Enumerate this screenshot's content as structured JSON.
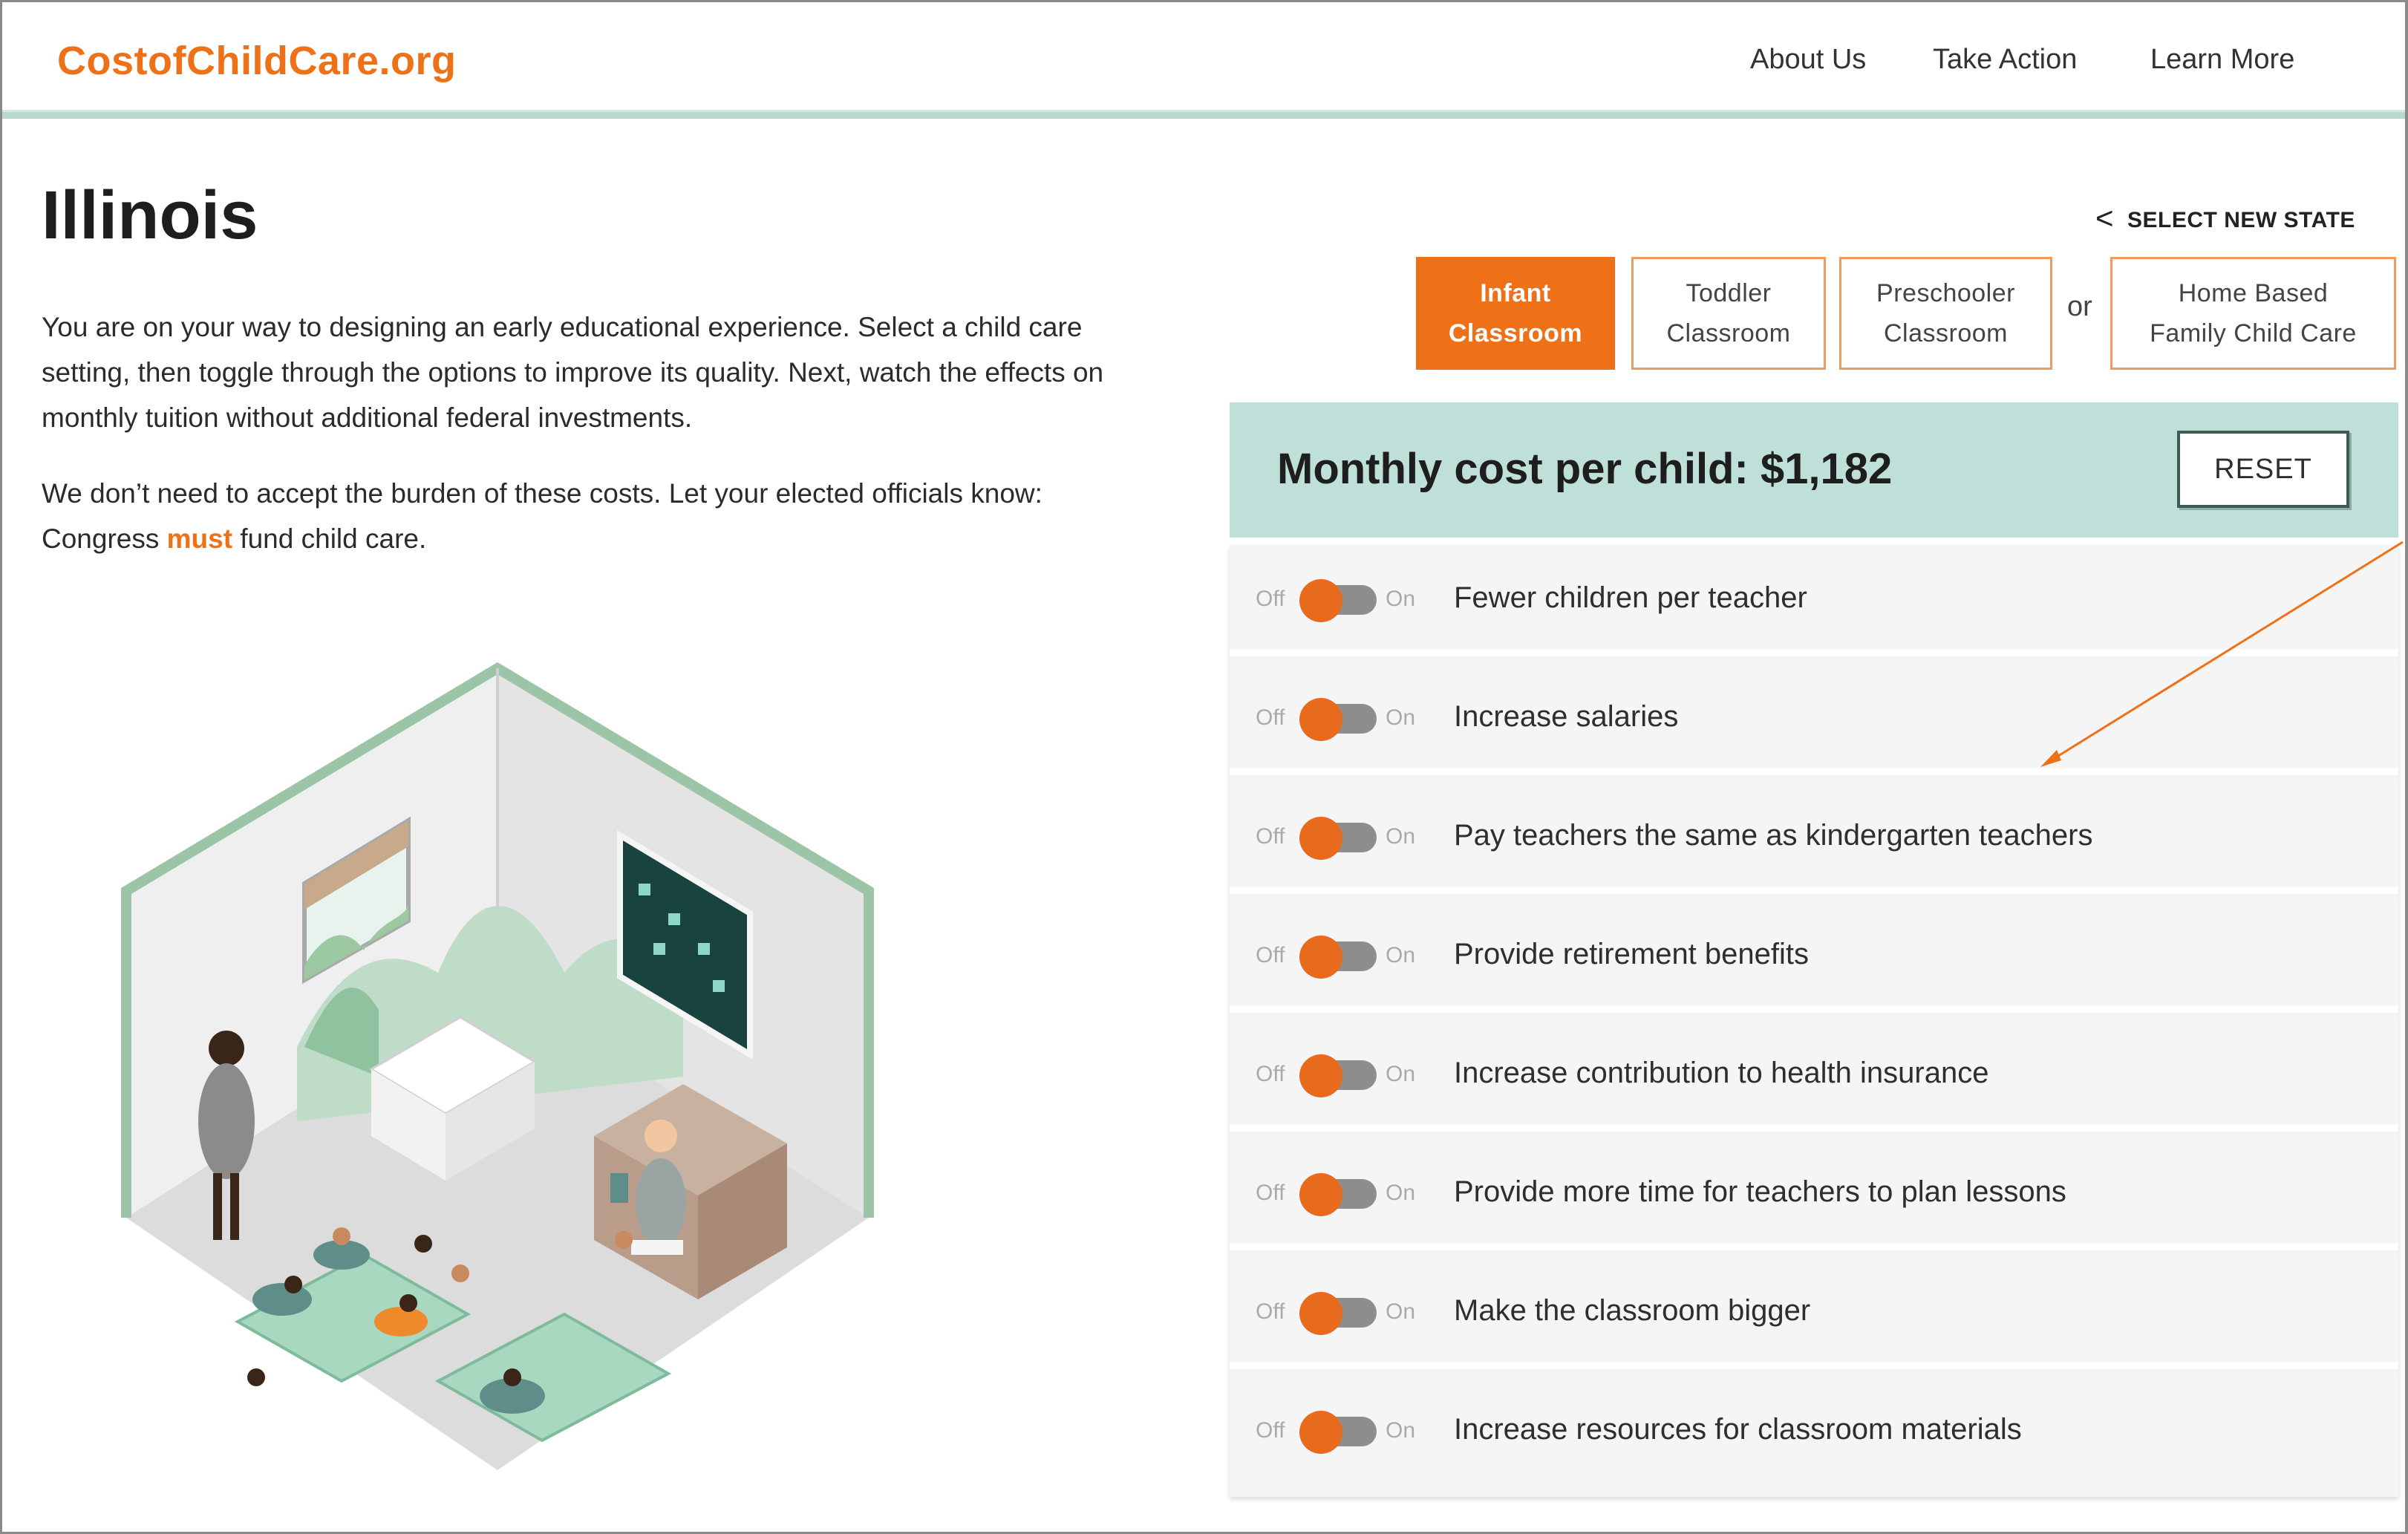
{
  "header": {
    "logo": "CostofChildCare.org",
    "nav": [
      "About Us",
      "Take Action",
      "Learn More"
    ]
  },
  "page": {
    "title": "Illinois",
    "intro_1": "You are on your way to designing an early educational experience. Select a child care setting, then toggle through the options to improve its quality. Next, watch the effects on monthly tuition without additional federal investments.",
    "intro_2_before": "We don’t need to accept the burden of these costs. Let your elected officials know: Congress ",
    "intro_2_emphasis": "must",
    "intro_2_after": " fund child care."
  },
  "selector": {
    "select_new_state": "SELECT NEW STATE",
    "chevron": "<",
    "or": "or",
    "tabs": [
      {
        "line1": "Infant",
        "line2": "Classroom",
        "active": true
      },
      {
        "line1": "Toddler",
        "line2": "Classroom",
        "active": false
      },
      {
        "line1": "Preschooler",
        "line2": "Classroom",
        "active": false
      },
      {
        "line1": "Home Based",
        "line2": "Family Child Care",
        "active": false
      }
    ]
  },
  "cost": {
    "label": "Monthly cost per child: $1,182",
    "reset": "RESET"
  },
  "toggle_text": {
    "off": "Off",
    "on": "On"
  },
  "options": [
    {
      "label": "Fewer children per teacher",
      "state": "off"
    },
    {
      "label": "Increase salaries",
      "state": "off"
    },
    {
      "label": "Pay teachers the same as kindergarten teachers",
      "state": "off"
    },
    {
      "label": "Provide retirement benefits",
      "state": "off"
    },
    {
      "label": "Increase contribution to health insurance",
      "state": "off"
    },
    {
      "label": "Provide more time for teachers to plan lessons",
      "state": "off"
    },
    {
      "label": "Make the classroom bigger",
      "state": "off"
    },
    {
      "label": "Increase resources for classroom materials",
      "state": "off"
    }
  ],
  "colors": {
    "brand_orange": "#ef7117",
    "panel_teal": "#bfe0d8",
    "toggle_track": "#8d8d8d"
  }
}
